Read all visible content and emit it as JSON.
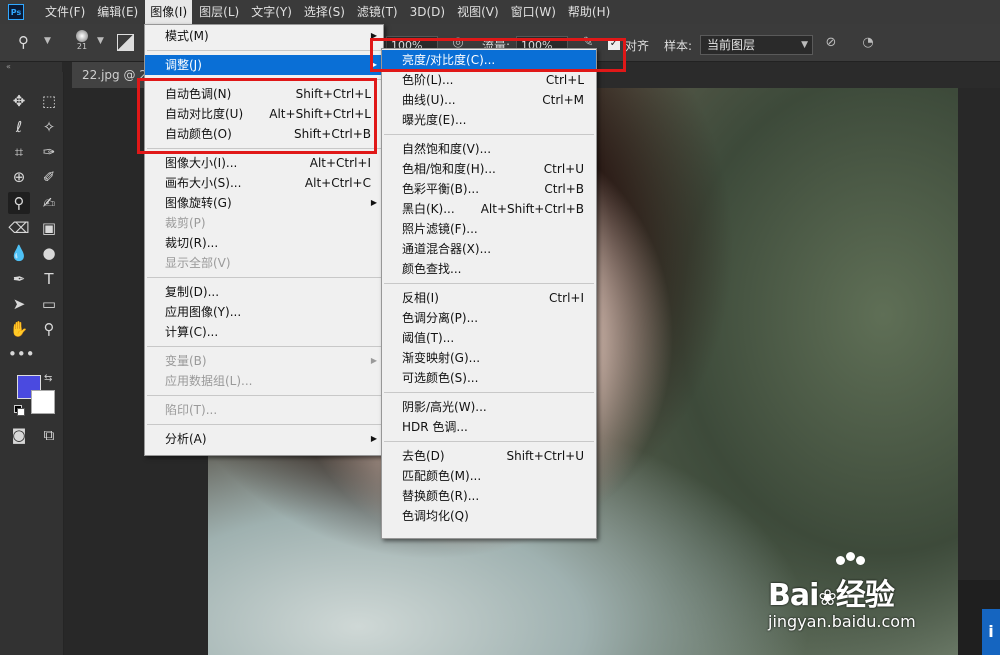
{
  "app": {
    "logo": "Ps"
  },
  "menubar": [
    {
      "label": "文件(F)"
    },
    {
      "label": "编辑(E)"
    },
    {
      "label": "图像(I)"
    },
    {
      "label": "图层(L)"
    },
    {
      "label": "文字(Y)"
    },
    {
      "label": "选择(S)"
    },
    {
      "label": "滤镜(T)"
    },
    {
      "label": "3D(D)"
    },
    {
      "label": "视图(V)"
    },
    {
      "label": "窗口(W)"
    },
    {
      "label": "帮助(H)"
    }
  ],
  "options": {
    "brush_size": "21",
    "opacity": "100%",
    "flow_label": "流量:",
    "flow": "100%",
    "aligned_label": "对齐",
    "sample_label": "样本:",
    "sample_value": "当前图层"
  },
  "doc_tab": {
    "label": "22.jpg @ 2("
  },
  "image_menu": {
    "items": [
      {
        "label": "模式(M)",
        "shortcut": "",
        "submenu": true,
        "disabled": false,
        "highlight": false
      },
      {
        "sep": true
      },
      {
        "label": "调整(J)",
        "shortcut": "",
        "submenu": true,
        "disabled": false,
        "highlight": true
      },
      {
        "sep": true
      },
      {
        "label": "自动色调(N)",
        "shortcut": "Shift+Ctrl+L",
        "disabled": false
      },
      {
        "label": "自动对比度(U)",
        "shortcut": "Alt+Shift+Ctrl+L",
        "disabled": false
      },
      {
        "label": "自动颜色(O)",
        "shortcut": "Shift+Ctrl+B",
        "disabled": false
      },
      {
        "sep": true
      },
      {
        "label": "图像大小(I)...",
        "shortcut": "Alt+Ctrl+I",
        "disabled": false
      },
      {
        "label": "画布大小(S)...",
        "shortcut": "Alt+Ctrl+C",
        "disabled": false
      },
      {
        "label": "图像旋转(G)",
        "shortcut": "",
        "submenu": true,
        "disabled": false
      },
      {
        "label": "裁剪(P)",
        "shortcut": "",
        "disabled": true
      },
      {
        "label": "裁切(R)...",
        "shortcut": "",
        "disabled": false
      },
      {
        "label": "显示全部(V)",
        "shortcut": "",
        "disabled": true
      },
      {
        "sep": true
      },
      {
        "label": "复制(D)...",
        "shortcut": "",
        "disabled": false
      },
      {
        "label": "应用图像(Y)...",
        "shortcut": "",
        "disabled": false
      },
      {
        "label": "计算(C)...",
        "shortcut": "",
        "disabled": false
      },
      {
        "sep": true
      },
      {
        "label": "变量(B)",
        "shortcut": "",
        "submenu": true,
        "disabled": true
      },
      {
        "label": "应用数据组(L)...",
        "shortcut": "",
        "disabled": true
      },
      {
        "sep": true
      },
      {
        "label": "陷印(T)...",
        "shortcut": "",
        "disabled": true
      },
      {
        "sep": true
      },
      {
        "label": "分析(A)",
        "shortcut": "",
        "submenu": true,
        "disabled": false
      }
    ]
  },
  "adjust_menu": {
    "items": [
      {
        "label": "亮度/对比度(C)...",
        "shortcut": "",
        "highlight": true
      },
      {
        "label": "色阶(L)...",
        "shortcut": "Ctrl+L"
      },
      {
        "label": "曲线(U)...",
        "shortcut": "Ctrl+M"
      },
      {
        "label": "曝光度(E)...",
        "shortcut": ""
      },
      {
        "sep": true
      },
      {
        "label": "自然饱和度(V)...",
        "shortcut": ""
      },
      {
        "label": "色相/饱和度(H)...",
        "shortcut": "Ctrl+U"
      },
      {
        "label": "色彩平衡(B)...",
        "shortcut": "Ctrl+B"
      },
      {
        "label": "黑白(K)...",
        "shortcut": "Alt+Shift+Ctrl+B"
      },
      {
        "label": "照片滤镜(F)...",
        "shortcut": ""
      },
      {
        "label": "通道混合器(X)...",
        "shortcut": ""
      },
      {
        "label": "颜色查找...",
        "shortcut": ""
      },
      {
        "sep": true
      },
      {
        "label": "反相(I)",
        "shortcut": "Ctrl+I"
      },
      {
        "label": "色调分离(P)...",
        "shortcut": ""
      },
      {
        "label": "阈值(T)...",
        "shortcut": ""
      },
      {
        "label": "渐变映射(G)...",
        "shortcut": ""
      },
      {
        "label": "可选颜色(S)...",
        "shortcut": ""
      },
      {
        "sep": true
      },
      {
        "label": "阴影/高光(W)...",
        "shortcut": ""
      },
      {
        "label": "HDR 色调...",
        "shortcut": ""
      },
      {
        "sep": true
      },
      {
        "label": "去色(D)",
        "shortcut": "Shift+Ctrl+U"
      },
      {
        "label": "匹配颜色(M)...",
        "shortcut": ""
      },
      {
        "label": "替换颜色(R)...",
        "shortcut": ""
      },
      {
        "label": "色调均化(Q)",
        "shortcut": ""
      }
    ]
  },
  "colors": {
    "foreground": "#4a4ae0",
    "background": "#ffffff",
    "highlight": "#0a6fd6",
    "annotation": "#e01818"
  },
  "watermark": {
    "brand": "Bai",
    "brand2": "经验",
    "url": "jingyan.baidu.com"
  },
  "corner_badge": "i"
}
